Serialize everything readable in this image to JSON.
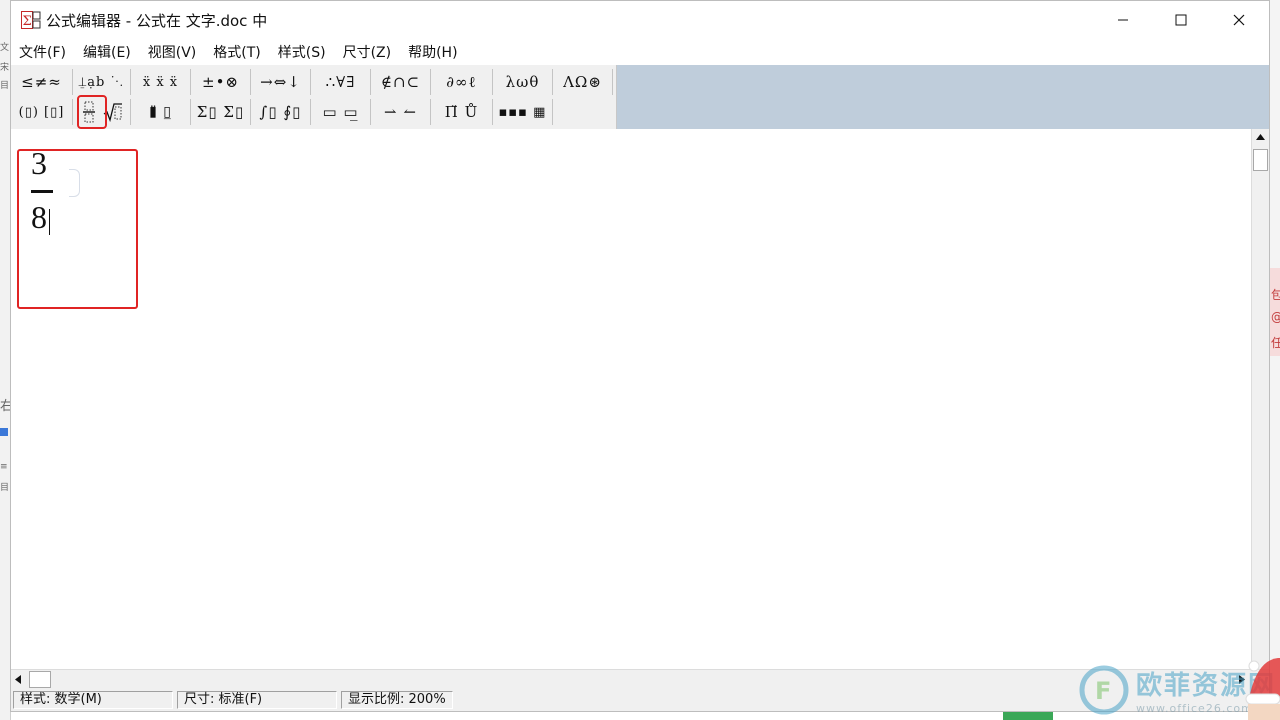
{
  "window": {
    "title": "公式编辑器 - 公式在 文字.doc 中",
    "controls": {
      "minimize": "—",
      "maximize": "☐",
      "close": "✕"
    }
  },
  "menu": [
    "文件(F)",
    "编辑(E)",
    "视图(V)",
    "格式(T)",
    "样式(S)",
    "尺寸(Z)",
    "帮助(H)"
  ],
  "toolbar": {
    "row1": [
      {
        "name": "relational-symbols",
        "glyph": "≤≠≈"
      },
      {
        "name": "spaces-ellipses",
        "glyph": "⍊ạb ⋱"
      },
      {
        "name": "embellishments",
        "glyph": "ẍ ẍ ẍ"
      },
      {
        "name": "operator-symbols",
        "glyph": "±•⊗"
      },
      {
        "name": "arrow-symbols",
        "glyph": "→⇔↓"
      },
      {
        "name": "logical-symbols",
        "glyph": "∴∀∃"
      },
      {
        "name": "set-theory-symbols",
        "glyph": "∉∩⊂"
      },
      {
        "name": "misc-symbols",
        "glyph": "∂∞ℓ"
      },
      {
        "name": "greek-lowercase",
        "glyph": "λωθ"
      },
      {
        "name": "greek-uppercase",
        "glyph": "ΛΩ⊛"
      }
    ],
    "row2": [
      {
        "name": "fence-templates",
        "glyph": "(▯) [▯]"
      },
      {
        "name": "fraction-radical-templates",
        "glyph": ""
      },
      {
        "name": "subscript-superscript-templates",
        "glyph": "▮̈ ▯̲"
      },
      {
        "name": "summation-templates",
        "glyph": "Σ▯ Σ▯"
      },
      {
        "name": "integral-templates",
        "glyph": "∫▯ ∮▯"
      },
      {
        "name": "underbar-overbar-templates",
        "glyph": "▭ ▭̲"
      },
      {
        "name": "labeled-arrow-templates",
        "glyph": "⇀ ↼"
      },
      {
        "name": "products-set-theory-templates",
        "glyph": "Π̈ Ů"
      },
      {
        "name": "matrix-templates",
        "glyph": "▪▪▪ ▦"
      }
    ]
  },
  "editor": {
    "numerator": "3",
    "denominator": "8"
  },
  "status": {
    "style": "样式: 数学(M)",
    "size": "尺寸: 标准(F)",
    "zoom": "显示比例: 200%"
  },
  "watermark": {
    "text": "欧菲资源网",
    "url": "www.office26.com"
  },
  "colors": {
    "highlight": "#e02424",
    "toolbar_bg": "#f0f0f0",
    "toolbar_area_bg": "#bfcddb",
    "watermark": "#4aa3c8"
  }
}
